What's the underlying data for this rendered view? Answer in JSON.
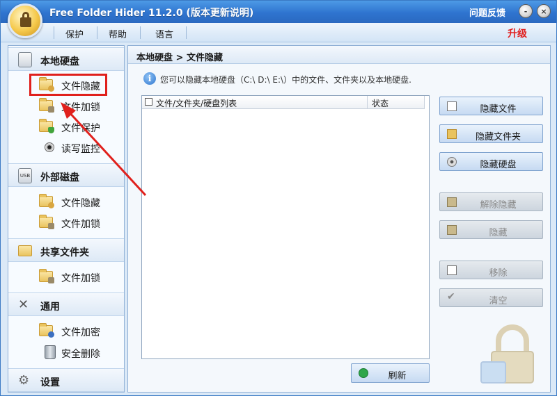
{
  "window": {
    "title": "Free Folder Hider 11.2.0 (版本更新说明)",
    "feedback": "问题反馈",
    "minimize": "-",
    "close": "×"
  },
  "menu": {
    "items": [
      "保护",
      "帮助",
      "语言"
    ],
    "upgrade": "升级"
  },
  "sidebar": {
    "sections": [
      {
        "label": "本地硬盘",
        "icon": "hard-disk-icon",
        "items": [
          {
            "label": "文件隐藏",
            "icon": "folder-hide-icon",
            "selected": true
          },
          {
            "label": "文件加锁",
            "icon": "folder-lock-icon"
          },
          {
            "label": "文件保护",
            "icon": "folder-protect-icon"
          },
          {
            "label": "读写监控",
            "icon": "monitor-icon"
          }
        ]
      },
      {
        "label": "外部磁盘",
        "icon": "usb-drive-icon",
        "items": [
          {
            "label": "文件隐藏",
            "icon": "folder-hide-icon"
          },
          {
            "label": "文件加锁",
            "icon": "folder-lock-icon"
          }
        ]
      },
      {
        "label": "共享文件夹",
        "icon": "shared-folder-icon",
        "items": [
          {
            "label": "文件加锁",
            "icon": "folder-lock-icon"
          }
        ]
      },
      {
        "label": "通用",
        "icon": "tools-icon",
        "items": [
          {
            "label": "文件加密",
            "icon": "folder-encrypt-icon"
          },
          {
            "label": "安全删除",
            "icon": "trash-icon"
          }
        ]
      },
      {
        "label": "设置",
        "icon": "settings-icon",
        "items": []
      }
    ]
  },
  "main": {
    "breadcrumb": "本地硬盘 > 文件隐藏",
    "info": "您可以隐藏本地硬盘（C:\\ D:\\ E:\\）中的文件、文件夹以及本地硬盘.",
    "columns": [
      "文件/文件夹/硬盘列表",
      "状态"
    ],
    "refresh": "刷新",
    "actions": {
      "hide_file": "隐藏文件",
      "hide_folder": "隐藏文件夹",
      "hide_disk": "隐藏硬盘",
      "unhide": "解除隐藏",
      "hide": "隐藏",
      "remove": "移除",
      "clear": "清空"
    }
  },
  "colors": {
    "accent": "#2f74cf",
    "highlight": "#e0201c",
    "upgrade": "#e02020"
  }
}
